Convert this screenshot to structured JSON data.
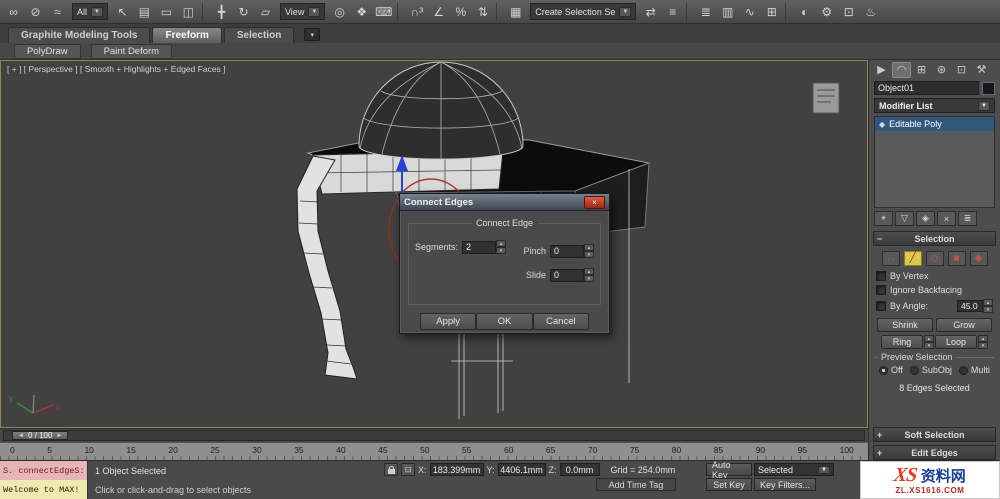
{
  "glyphs": {
    "spinner_up": "▴",
    "spinner_down": "▾",
    "dropdown_arrow": "▼",
    "close": "×",
    "collapse": "−",
    "expand": "+",
    "slider_left": "◄",
    "slider_right": "►",
    "abs_mode": "⊡"
  },
  "toolbar": {
    "items": [
      {
        "type": "icon",
        "name": "select-and-link-icon",
        "glyph": "∞"
      },
      {
        "type": "icon",
        "name": "unlink-selection-icon",
        "glyph": "⊘"
      },
      {
        "type": "icon",
        "name": "bind-to-spacewarp-icon",
        "glyph": "≈"
      },
      {
        "type": "dropdown",
        "name": "selection-filter-dropdown",
        "value": "All"
      },
      {
        "type": "icon",
        "name": "select-object-icon",
        "glyph": "↖"
      },
      {
        "type": "icon",
        "name": "select-by-name-icon",
        "glyph": "▤"
      },
      {
        "type": "icon",
        "name": "selection-region-icon",
        "glyph": "▭"
      },
      {
        "type": "icon",
        "name": "window-crossing-icon",
        "glyph": "◫"
      },
      {
        "type": "gap"
      },
      {
        "type": "icon",
        "name": "select-and-move-icon",
        "glyph": "╋"
      },
      {
        "type": "icon",
        "name": "select-and-rotate-icon",
        "glyph": "↻"
      },
      {
        "type": "icon",
        "name": "select-and-scale-icon",
        "glyph": "▱"
      },
      {
        "type": "dropdown",
        "name": "reference-coordinate-dropdown",
        "value": "View"
      },
      {
        "type": "icon",
        "name": "use-pivot-center-icon",
        "glyph": "◎"
      },
      {
        "type": "icon",
        "name": "select-and-manipulate-icon",
        "glyph": "❖"
      },
      {
        "type": "icon",
        "name": "keyboard-override-icon",
        "glyph": "⌨"
      },
      {
        "type": "gap"
      },
      {
        "type": "icon",
        "name": "snap-toggle-3d-icon",
        "glyph": "∩³"
      },
      {
        "type": "icon",
        "name": "angle-snap-icon",
        "glyph": "∠"
      },
      {
        "type": "icon",
        "name": "percent-snap-icon",
        "glyph": "%"
      },
      {
        "type": "icon",
        "name": "spinner-snap-icon",
        "glyph": "⇅"
      },
      {
        "type": "gap"
      },
      {
        "type": "icon",
        "name": "edit-named-selection-sets-icon",
        "glyph": "▦"
      },
      {
        "type": "dropdown",
        "name": "named-selection-set-dropdown",
        "value": "Create Selection Se"
      },
      {
        "type": "icon",
        "name": "mirror-icon",
        "glyph": "⇄"
      },
      {
        "type": "icon",
        "name": "align-icon",
        "glyph": "≡"
      },
      {
        "type": "gap"
      },
      {
        "type": "icon",
        "name": "layer-manager-icon",
        "glyph": "≣"
      },
      {
        "type": "icon",
        "name": "graphite-ribbon-toggle-icon",
        "glyph": "▥"
      },
      {
        "type": "icon",
        "name": "curve-editor-icon",
        "glyph": "∿"
      },
      {
        "type": "icon",
        "name": "schematic-view-icon",
        "glyph": "⊞"
      },
      {
        "type": "gap"
      },
      {
        "type": "icon",
        "name": "material-editor-icon",
        "glyph": "◐"
      },
      {
        "type": "icon",
        "name": "render-setup-icon",
        "glyph": "⚙"
      },
      {
        "type": "icon",
        "name": "rendered-frame-icon",
        "glyph": "⊡"
      },
      {
        "type": "icon",
        "name": "render-production-icon",
        "glyph": "♨"
      }
    ]
  },
  "ribbon": {
    "tabs": [
      {
        "label": "Graphite Modeling Tools",
        "active": false
      },
      {
        "label": "Freeform",
        "active": true
      },
      {
        "label": "Selection",
        "active": false
      }
    ],
    "more_icon": "▾",
    "panels": [
      "PolyDraw",
      "Paint Deform"
    ]
  },
  "viewport": {
    "label": "[ + ] [ Perspective ] [ Smooth + Highlights + Edged Faces ]",
    "axis_x_label": "x",
    "axis_y_label": "y"
  },
  "dialog": {
    "title": "Connect Edges",
    "group_label": "Connect Edge",
    "segments_label": "Segments:",
    "segments_value": "2",
    "pinch_label": "Pinch",
    "pinch_value": "0",
    "slide_label": "Slide",
    "slide_value": "0",
    "apply_label": "Apply",
    "ok_label": "OK",
    "cancel_label": "Cancel"
  },
  "command_panel": {
    "tabs": [
      {
        "name": "create-tab",
        "glyph": "▶",
        "active": false
      },
      {
        "name": "modify-tab",
        "glyph": "◠",
        "active": true
      },
      {
        "name": "hierarchy-tab",
        "glyph": "⊞",
        "active": false
      },
      {
        "name": "motion-tab",
        "glyph": "⊛",
        "active": false
      },
      {
        "name": "display-tab",
        "glyph": "⊡",
        "active": false
      },
      {
        "name": "utilities-tab",
        "glyph": "⚒",
        "active": false
      }
    ],
    "object_name": "Object01",
    "modifier_list_label": "Modifier List",
    "stack_item": "Editable Poly",
    "stack_item_icon": "◆",
    "stack_tools": [
      {
        "name": "pin-stack-button",
        "glyph": "⌖"
      },
      {
        "name": "show-end-result-button",
        "glyph": "▽"
      },
      {
        "name": "make-unique-button",
        "glyph": "◈"
      },
      {
        "name": "remove-modifier-button",
        "glyph": "×"
      },
      {
        "name": "configure-modifier-sets-button",
        "glyph": "≣"
      }
    ],
    "selection": {
      "title": "Selection",
      "subobject_icons": [
        {
          "name": "vertex-mode-icon",
          "glyph": "∴",
          "active": false
        },
        {
          "name": "edge-mode-icon",
          "glyph": "╱",
          "active": true
        },
        {
          "name": "border-mode-icon",
          "glyph": "◇",
          "active": false
        },
        {
          "name": "polygon-mode-icon",
          "glyph": "■",
          "active": false
        },
        {
          "name": "element-mode-icon",
          "glyph": "◆",
          "active": false
        }
      ],
      "by_vertex_label": "By Vertex",
      "ignore_backfacing_label": "Ignore Backfacing",
      "by_angle_label": "By Angle:",
      "by_angle_value": "45.0",
      "shrink_label": "Shrink",
      "grow_label": "Grow",
      "ring_label": "Ring",
      "loop_label": "Loop",
      "preview_label": "Preview Selection",
      "preview_options": [
        {
          "label": "Off",
          "selected": true
        },
        {
          "label": "SubObj",
          "selected": false
        },
        {
          "label": "Multi",
          "selected": false
        }
      ],
      "status_text": "8 Edges Selected"
    },
    "rollouts": {
      "soft_selection": "Soft Selection",
      "edit_edges": "Edit Edges"
    }
  },
  "timeline": {
    "slider_value": "0 / 100",
    "ticks": [
      "0",
      "5",
      "10",
      "15",
      "20",
      "25",
      "30",
      "35",
      "40",
      "45",
      "50",
      "55",
      "60",
      "65",
      "70",
      "75",
      "80",
      "85",
      "90",
      "95",
      "100"
    ]
  },
  "status_bar": {
    "listener_line1": "S. connectEdgeS:",
    "listener_line2": "Welcome to MAX!",
    "selection_status": "1 Object Selected",
    "prompt_text": "Click or click-and-drag to select objects",
    "x_label": "X:",
    "x_value": "183.399mm",
    "y_label": "Y:",
    "y_value": "4406.1mm",
    "z_label": "Z:",
    "z_value": "0.0mm",
    "grid_text": "Grid = 254.0mm",
    "add_time_tag_label": "Add Time Tag",
    "auto_key_label": "Auto Key",
    "set_key_label": "Set Key",
    "selected_dropdown_value": "Selected",
    "key_filters_label": "Key Filters..."
  },
  "watermark": {
    "logo_text": "XS",
    "site_name": "资料网",
    "url": "ZL.XS1616.COM"
  }
}
